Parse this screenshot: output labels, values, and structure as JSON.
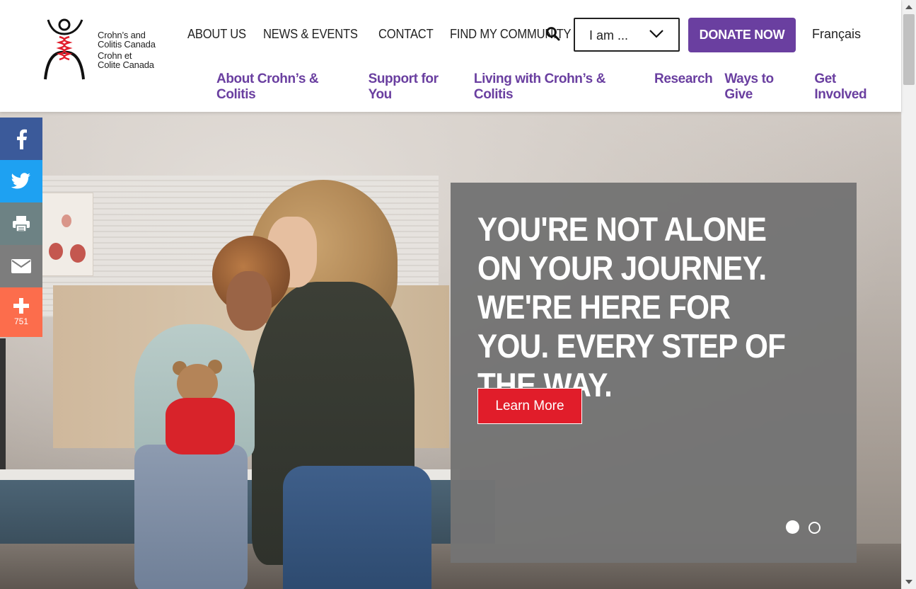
{
  "logo": {
    "alt": "Crohn's and Colitis Canada logo",
    "lines": [
      "Crohn’s and",
      "Colitis Canada",
      "Crohn et",
      "Colite Canada"
    ]
  },
  "utility_nav": {
    "items": [
      "ABOUT US",
      "NEWS & EVENTS",
      "CONTACT",
      "FIND MY COMMUNITY"
    ],
    "search_icon": "search-icon"
  },
  "iam_select": {
    "value": "I am ..."
  },
  "donate": {
    "label": "DONATE NOW"
  },
  "language": {
    "label": "Français"
  },
  "main_nav": {
    "items": [
      "About Crohn’s & Colitis",
      "Support for You",
      "Living with Crohn’s & Colitis",
      "Research",
      "Ways to Give",
      "Get Involved"
    ]
  },
  "hero": {
    "title": "YOU'RE NOT ALONE ON YOUR JOURNEY. WE'RE HERE FOR YOU. EVERY STEP OF THE WAY.",
    "cta": "Learn More",
    "slides": {
      "count": 2,
      "active": 1
    }
  },
  "share": {
    "buttons": [
      "facebook-icon",
      "twitter-icon",
      "print-icon",
      "email-icon",
      "plus-icon"
    ],
    "count": "751"
  },
  "colors": {
    "brand_purple": "#6a3fa0",
    "cta_red": "#e11d2a",
    "facebook": "#3b5a9a",
    "twitter": "#1ea1f2",
    "print": "#6d8284",
    "email": "#7d7d7d",
    "more": "#fc6d4c",
    "slide_panel": "#747474"
  }
}
